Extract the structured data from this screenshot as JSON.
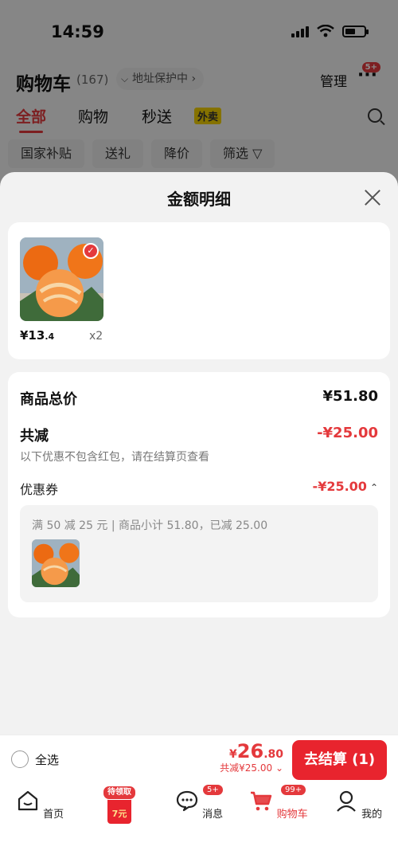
{
  "status_bar": {
    "time": "14:59"
  },
  "cart_header": {
    "title": "购物车",
    "count": "(167)",
    "address": "地址保护中 ›",
    "manage": "管理",
    "more": "···",
    "more_badge": "5+"
  },
  "top_tabs": [
    {
      "label": "全部",
      "active": true
    },
    {
      "label": "购物",
      "active": false
    },
    {
      "label": "秒送",
      "active": false
    }
  ],
  "takeout_tag": "外卖",
  "filters": [
    "国家补贴",
    "送礼",
    "降价",
    "筛选 ▽"
  ],
  "sheet": {
    "title": "金额明细",
    "product": {
      "price_main": "¥13",
      "price_dec": ".4",
      "qty": "x2"
    },
    "total_label": "商品总价",
    "total_value": "¥51.80",
    "reduce_label": "共减",
    "reduce_value": "-¥25.00",
    "reduce_note": "以下优惠不包含红包，请在结算页查看",
    "coupon_label": "优惠券",
    "coupon_value": "-¥25.00",
    "coupon_desc": "满 50 减 25 元 | 商品小计 51.80，已减 25.00"
  },
  "checkout": {
    "select_all": "全选",
    "currency": "¥",
    "amount_int": "26",
    "amount_dec": ".80",
    "saved": "共减¥25.00 ⌄",
    "button": "去结算 (1)"
  },
  "nav": {
    "home": "首页",
    "redpack_tag": "待领取",
    "redpack_value": "7元",
    "messages": "消息",
    "messages_badge": "5+",
    "cart": "购物车",
    "cart_badge": "99+",
    "mine": "我的"
  },
  "colors": {
    "accent": "#e4393c",
    "button": "#e8242e"
  }
}
